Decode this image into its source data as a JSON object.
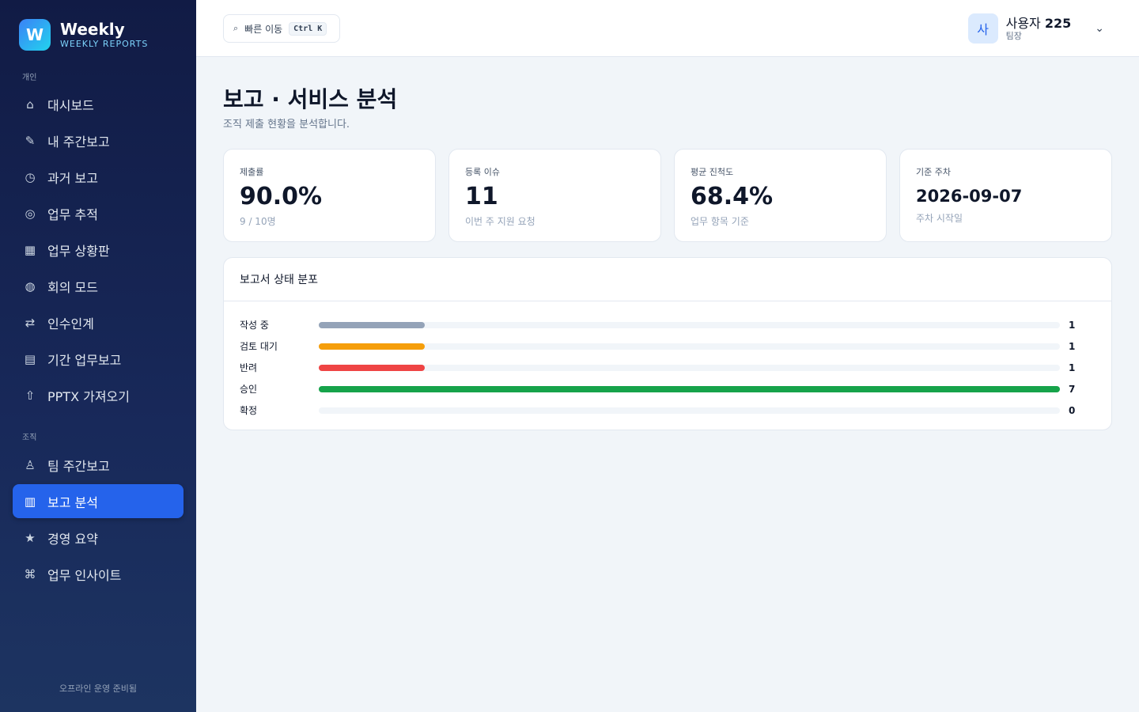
{
  "brand": {
    "logo_letter": "W",
    "title": "Weekly",
    "subtitle": "WEEKLY REPORTS"
  },
  "sidebar": {
    "section_personal": "개인",
    "personal_items": [
      {
        "icon": "home-icon",
        "glyph": "⌂",
        "label": "대시보드"
      },
      {
        "icon": "pencil-icon",
        "glyph": "✎",
        "label": "내 주간보고"
      },
      {
        "icon": "clock-icon",
        "glyph": "◷",
        "label": "과거 보고"
      },
      {
        "icon": "target-icon",
        "glyph": "◎",
        "label": "업무 추적"
      },
      {
        "icon": "grid-icon",
        "glyph": "▦",
        "label": "업무 상황판"
      },
      {
        "icon": "globe-icon",
        "glyph": "◍",
        "label": "회의 모드"
      },
      {
        "icon": "swap-icon",
        "glyph": "⇄",
        "label": "인수인계"
      },
      {
        "icon": "list-icon",
        "glyph": "▤",
        "label": "기간 업무보고"
      },
      {
        "icon": "upload-icon",
        "glyph": "⇧",
        "label": "PPTX 가져오기"
      }
    ],
    "section_org": "조직",
    "org_items": [
      {
        "icon": "team-icon",
        "glyph": "♙",
        "label": "팀 주간보고"
      },
      {
        "icon": "chart-icon",
        "glyph": "▥",
        "label": "보고 분석",
        "active": true
      },
      {
        "icon": "star-icon",
        "glyph": "★",
        "label": "경영 요약"
      },
      {
        "icon": "command-icon",
        "glyph": "⌘",
        "label": "업무 인사이트"
      }
    ],
    "footer": "오프라인 운영 준비됨"
  },
  "topbar": {
    "search_icon": "search-icon",
    "search_glyph": "⌕",
    "quick_label": "빠른 이동",
    "quick_shortcut": "Ctrl K",
    "user_avatar": "사",
    "user_name_prefix": "사용자",
    "user_name_number": "225",
    "user_role": "팀장",
    "chevron_glyph": "⌄"
  },
  "page": {
    "title": "보고 · 서비스 분석",
    "subtitle": "조직 제출 현황을 분석합니다."
  },
  "cards": [
    {
      "label": "제출률",
      "value": "90.0%",
      "note": "9 / 10명"
    },
    {
      "label": "등록 이슈",
      "value": "11",
      "note": "이번 주 지원 요청"
    },
    {
      "label": "평균 진척도",
      "value": "68.4%",
      "note": "업무 항목 기준"
    },
    {
      "label": "기준 주차",
      "value": "2026-09-07",
      "note": "주차 시작일"
    }
  ],
  "distribution": {
    "title": "보고서 상태 분포",
    "max": 7,
    "rows": [
      {
        "label": "작성 중",
        "count": 1,
        "color": "#94a3b8"
      },
      {
        "label": "검토 대기",
        "count": 1,
        "color": "#f59e0b"
      },
      {
        "label": "반려",
        "count": 1,
        "color": "#ef4444"
      },
      {
        "label": "승인",
        "count": 7,
        "color": "#16a34a"
      },
      {
        "label": "확정",
        "count": 0,
        "color": "#94a3b8"
      }
    ]
  }
}
